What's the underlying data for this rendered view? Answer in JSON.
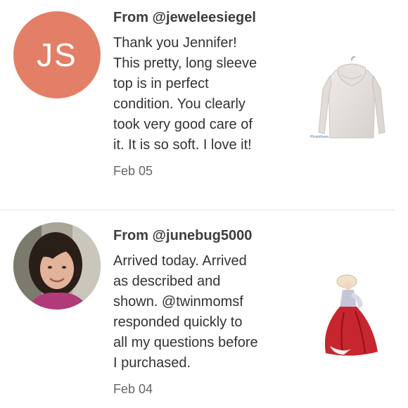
{
  "reviews": [
    {
      "avatar_initials": "JS",
      "avatar_color": "#e37f66",
      "from": "From @jeweleesiegel",
      "lines": [
        "Thank you Jennifer!",
        "This pretty, long sleeve",
        "top is in perfect",
        "condition. You clearly",
        "took very good care of",
        "it. It is so soft. I love it!"
      ],
      "date": "Feb 05",
      "thumb_watermark": "PhotoRoom"
    },
    {
      "from": "From @junebug5000",
      "lines": [
        "Arrived today. Arrived",
        "as described and",
        "shown. @twinmomsf",
        "responded quickly to",
        "all my questions before",
        "I purchased."
      ],
      "date": "Feb 04"
    }
  ]
}
